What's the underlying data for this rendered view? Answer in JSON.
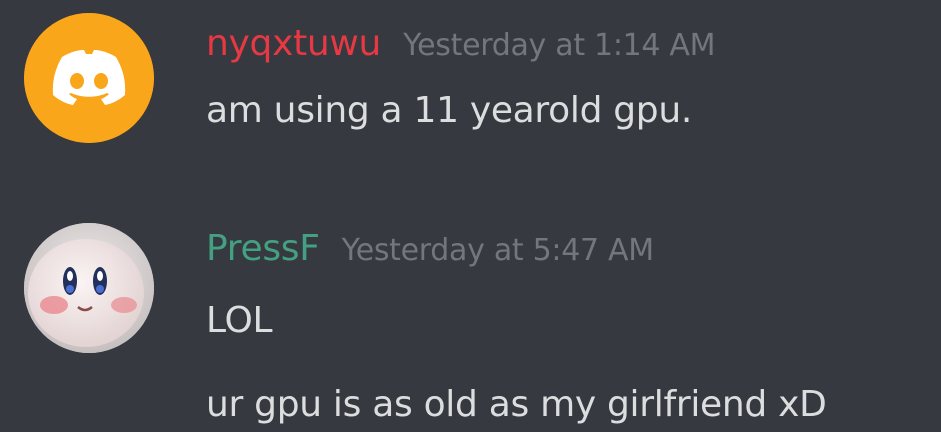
{
  "messages": [
    {
      "username": "nyqxtuwu",
      "username_color": "#e63943",
      "timestamp": "Yesterday at 1:14 AM",
      "avatar": {
        "icon": "discord-logo-icon",
        "background": "#faa61a"
      },
      "lines": [
        "am using a 11 yearold gpu."
      ]
    },
    {
      "username": "PressF",
      "username_color": "#43a080",
      "timestamp": "Yesterday at 5:47 AM",
      "avatar": {
        "icon": "kirby-plush-photo-icon",
        "background": "#dcd6d6"
      },
      "lines": [
        "LOL",
        "ur gpu is as old as my girlfriend xD"
      ]
    }
  ]
}
